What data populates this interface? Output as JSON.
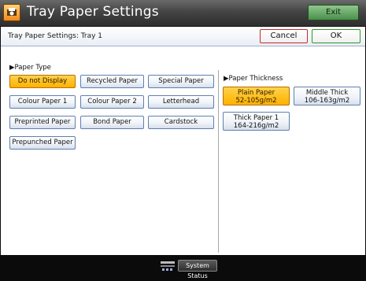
{
  "titlebar": {
    "title": "Tray Paper Settings",
    "exit_label": "Exit",
    "icon": "printer-settings-icon"
  },
  "subheader": {
    "text": "Tray Paper Settings: Tray 1",
    "cancel_label": "Cancel",
    "ok_label": "OK"
  },
  "paper_type": {
    "label": "Paper Type",
    "selected": "Do not Display",
    "options": [
      "Do not Display",
      "Recycled Paper",
      "Special Paper",
      "Colour Paper 1",
      "Colour Paper 2",
      "Letterhead",
      "Preprinted Paper",
      "Bond Paper",
      "Cardstock",
      "Prepunched Paper"
    ]
  },
  "paper_thickness": {
    "label": "Paper Thickness",
    "options": [
      {
        "line1": "Plain Paper",
        "line2": "52-105g/m2",
        "selected": true
      },
      {
        "line1": "Middle Thick",
        "line2": "106-163g/m2",
        "selected": false
      },
      {
        "line1": "Thick Paper 1",
        "line2": "164-216g/m2",
        "selected": false
      }
    ]
  },
  "status_bar": {
    "status_label": "System Status",
    "icon": "system-status-icon"
  },
  "colors": {
    "selected_button": "#ffb100",
    "cancel_border": "#c62a2a",
    "ok_border": "#2a9a2a",
    "exit_button": "#4b8f4b"
  }
}
